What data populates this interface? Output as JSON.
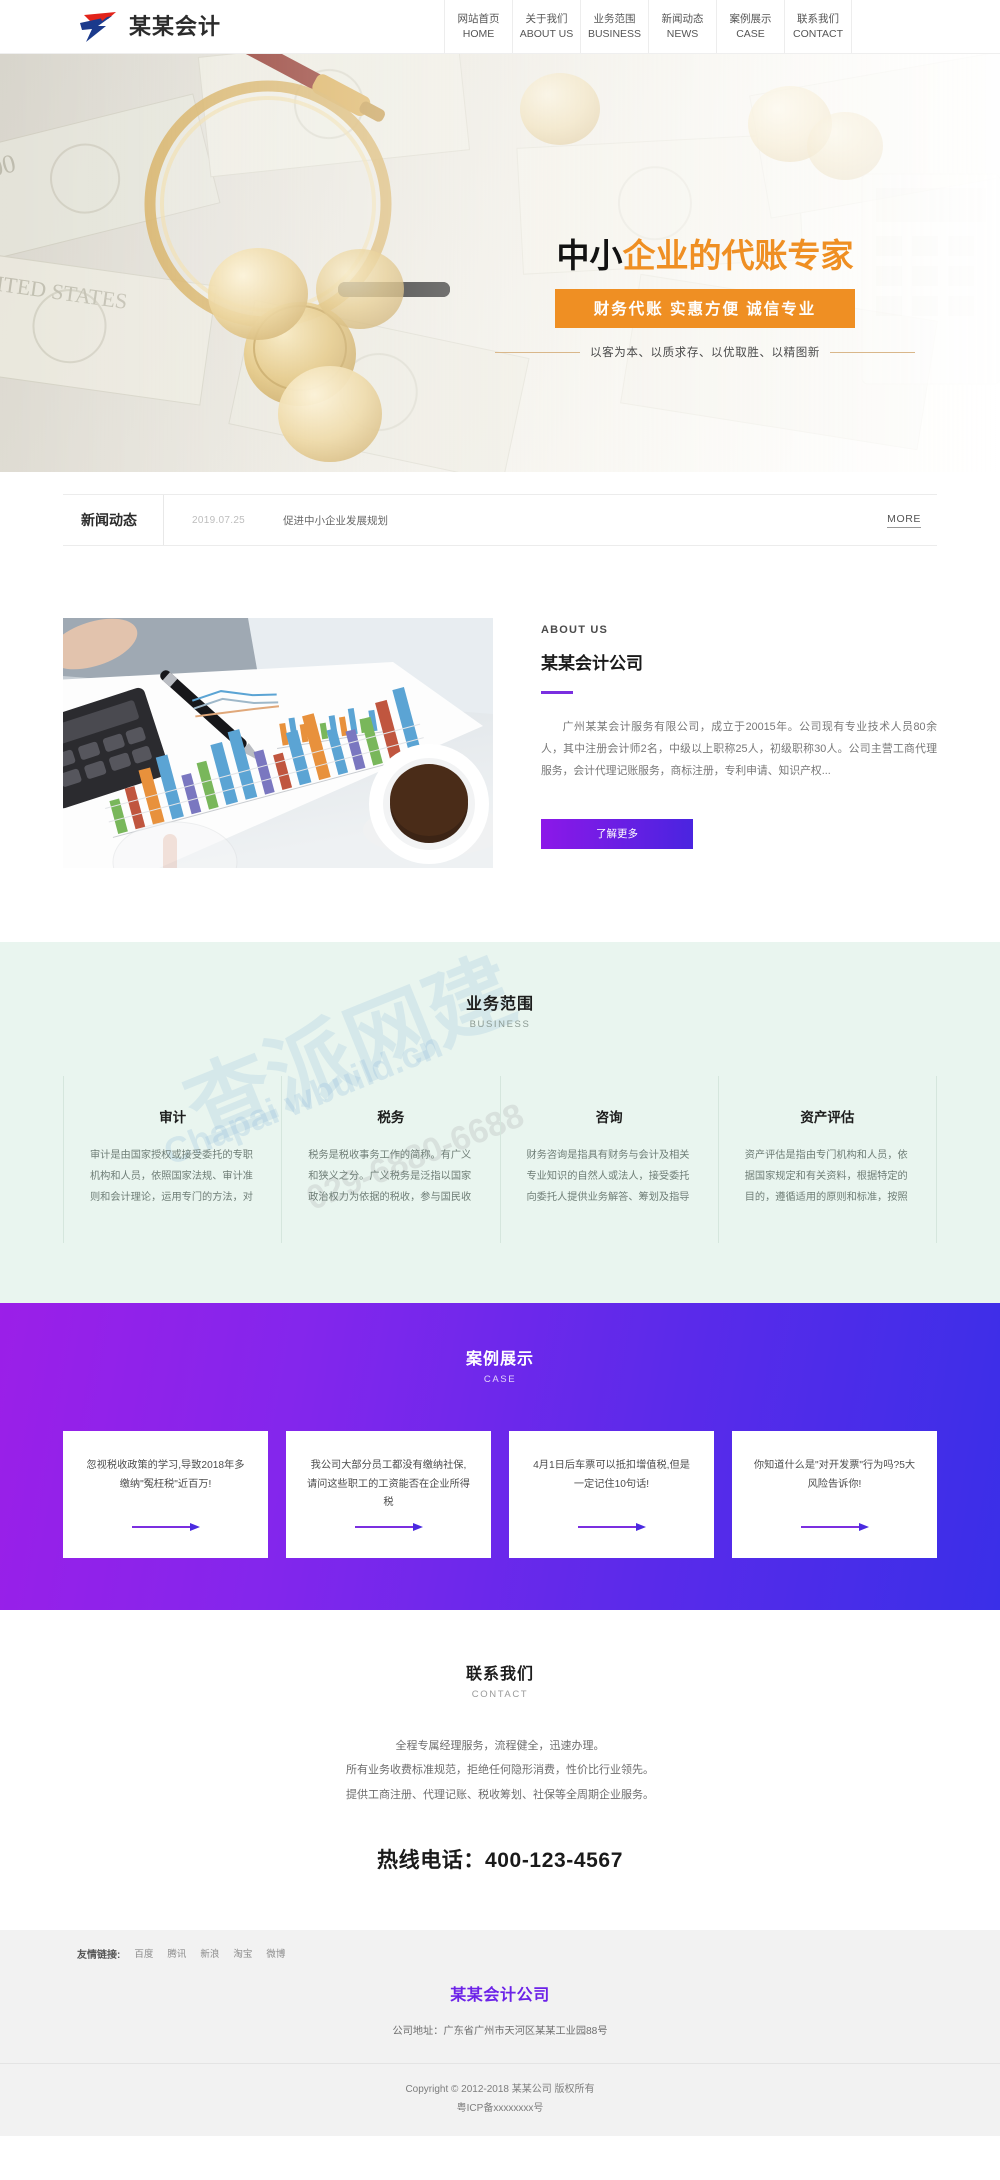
{
  "header": {
    "logo_text": "某某会计",
    "logo_icon": "swoosh-logo-icon",
    "nav": [
      {
        "cn": "网站首页",
        "en": "HOME"
      },
      {
        "cn": "关于我们",
        "en": "ABOUT US"
      },
      {
        "cn": "业务范围",
        "en": "BUSINESS"
      },
      {
        "cn": "新闻动态",
        "en": "NEWS"
      },
      {
        "cn": "案例展示",
        "en": "CASE"
      },
      {
        "cn": "联系我们",
        "en": "CONTACT"
      }
    ]
  },
  "hero": {
    "title_dark": "中小",
    "title_orange": "企业的代账专家",
    "subtitle": "财务代账  实惠方便  诚信专业",
    "slogan": "以客为本、以质求存、以优取胜、以精图新",
    "accent_color": "#ef8f23"
  },
  "newsbar": {
    "label": "新闻动态",
    "date": "2019.07.25",
    "title": "促进中小企业发展规划",
    "more": "MORE"
  },
  "about": {
    "en_title": "ABOUT US",
    "cn_title": "某某会计公司",
    "body": "广州某某会计服务有限公司，成立于20015年。公司现有专业技术人员80余人，其中注册会计师2名，中级以上职称25人，初级职称30人。公司主营工商代理服务，会计代理记账服务，商标注册，专利申请、知识产权...",
    "button": "了解更多",
    "accent_color": "#7a2fe0"
  },
  "business": {
    "cn_title": "业务范围",
    "en_title": "BUSINESS",
    "bg_color": "#e9f5ef",
    "cards": [
      {
        "title": "审计",
        "desc": "审计是由国家授权或接受委托的专职机构和人员，依照国家法规、审计准则和会计理论，运用专门的方法，对"
      },
      {
        "title": "税务",
        "desc": "税务是税收事务工作的简称。有广义和狭义之分。广义税务是泛指以国家政治权力为依据的税收，参与国民收"
      },
      {
        "title": "咨询",
        "desc": "财务咨询是指具有财务与会计及相关专业知识的自然人或法人，接受委托向委托人提供业务解答、筹划及指导"
      },
      {
        "title": "资产评估",
        "desc": "资产评估是指由专门机构和人员，依据国家规定和有关资料，根据特定的目的，遵循适用的原则和标准，按照"
      }
    ],
    "watermark_a": "查派网建",
    "watermark_b": "Chapai wbuild.cn",
    "watermark_c": "029-6880-6688"
  },
  "case": {
    "cn_title": "案例展示",
    "en_title": "CASE",
    "cards": [
      {
        "text": "忽视税收政策的学习,导致2018年多缴纳\"冤枉税\"近百万!"
      },
      {
        "text": "我公司大部分员工都没有缴纳社保,请问这些职工的工资能否在企业所得税"
      },
      {
        "text": "4月1日后车票可以抵扣增值税,但是一定记住10句话!"
      },
      {
        "text": "你知道什么是\"对开发票\"行为吗?5大风险告诉你!"
      }
    ]
  },
  "contact": {
    "cn_title": "联系我们",
    "en_title": "CONTACT",
    "lines": [
      "全程专属经理服务，流程健全，迅速办理。",
      "所有业务收费标准规范，拒绝任何隐形消费，性价比行业领先。",
      "提供工商注册、代理记账、税收筹划、社保等全周期企业服务。"
    ],
    "phone": "热线电话：400-123-4567"
  },
  "footer": {
    "links_label": "友情链接:",
    "links": [
      "百度",
      "腾讯",
      "新浪",
      "淘宝",
      "微博"
    ],
    "company": "某某会计公司",
    "address": "公司地址：广东省广州市天河区某某工业园88号",
    "copyright": "Copyright © 2012-2018 某某公司 版权所有",
    "icp": "粤ICP备xxxxxxxx号",
    "brand_color": "#6c22e8"
  }
}
